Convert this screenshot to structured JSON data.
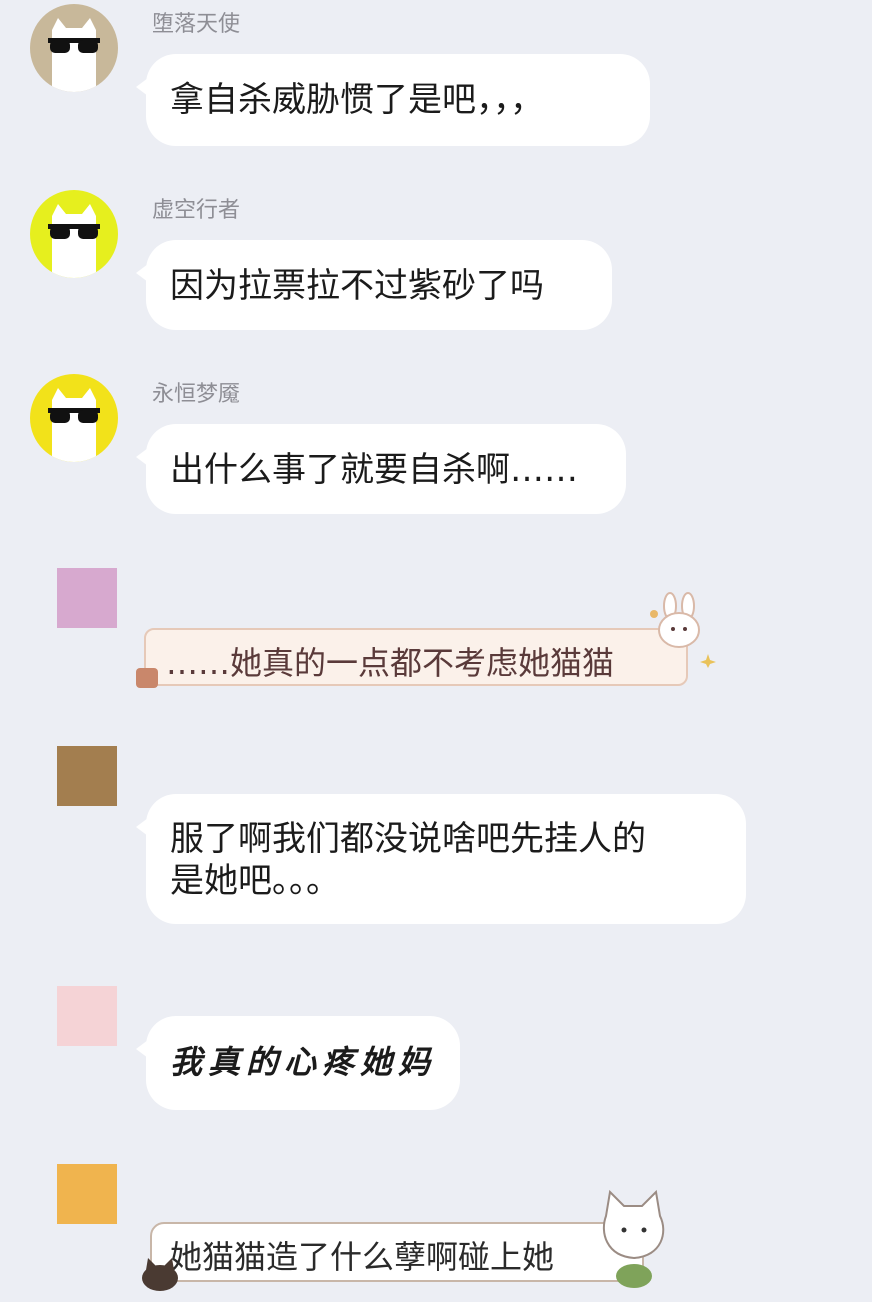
{
  "messages": [
    {
      "sender": "堕落天使",
      "text": "拿自杀威胁惯了是吧，，，",
      "avatar_bg": "#c8b89a"
    },
    {
      "sender": "虚空行者",
      "text": "因为拉票拉不过紫砂了吗",
      "avatar_bg": "#e6ef1e"
    },
    {
      "sender": "永恒梦魇",
      "text": "出什么事了就要自杀啊……",
      "avatar_bg": "#f2e21a"
    },
    {
      "text": "……她真的一点都不考虑她猫猫",
      "avatar_color": "#d7a9cf"
    },
    {
      "text_line1": "服了啊我们都没说啥吧先挂人的",
      "text_line2": "是她吧。。。",
      "avatar_color": "#a37e4f"
    },
    {
      "text": "我真的心疼她妈",
      "avatar_color": "#f5d3d6"
    },
    {
      "text": "她猫猫造了什么孽啊碰上她",
      "avatar_color": "#f0b44e"
    }
  ]
}
